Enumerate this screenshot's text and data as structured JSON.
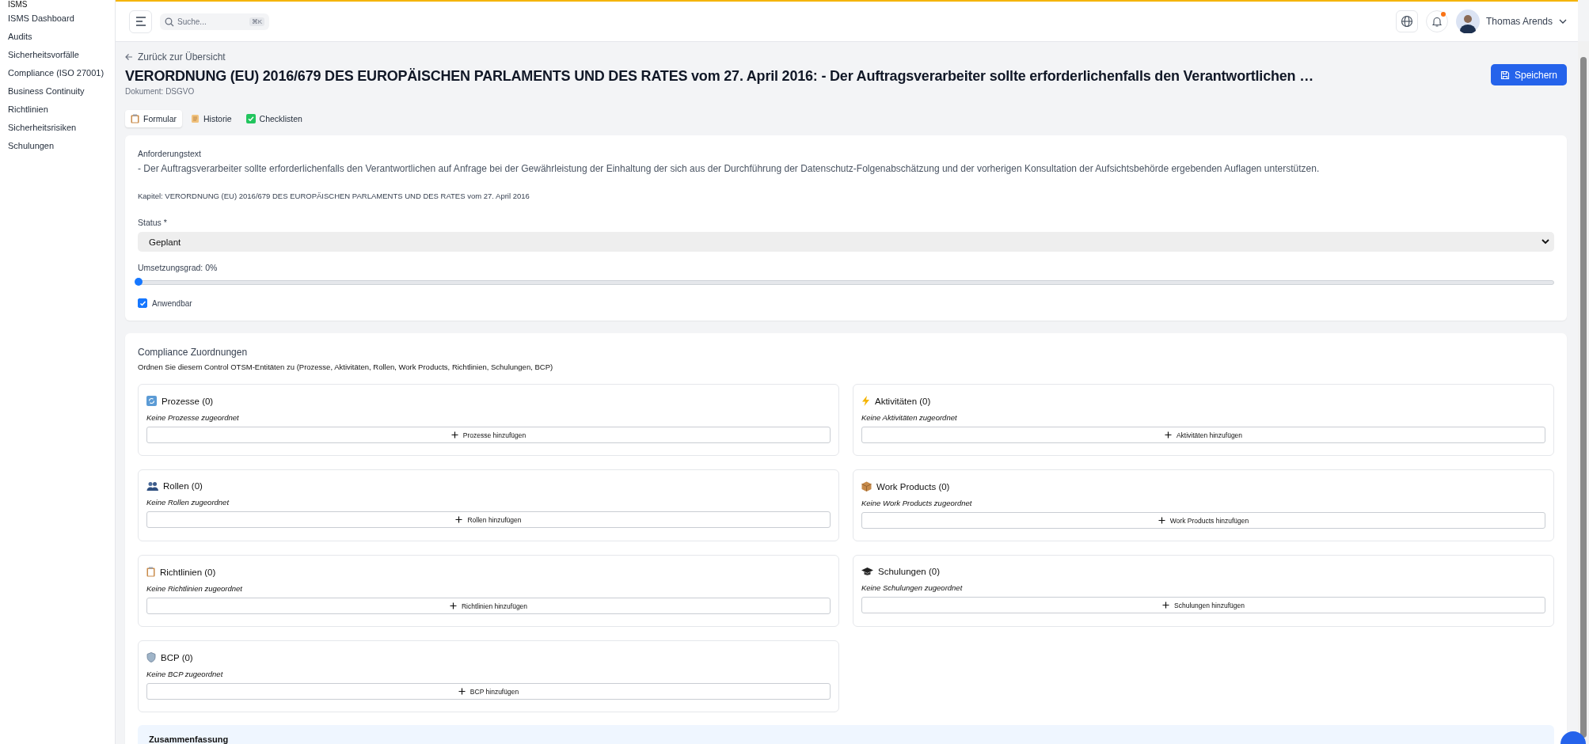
{
  "sidebar": {
    "section": "ISMS",
    "items": [
      {
        "label": "ISMS Dashboard",
        "selected": false
      },
      {
        "label": "Audits",
        "selected": false
      },
      {
        "label": "Sicherheitsvorfälle",
        "selected": false
      },
      {
        "label": "Compliance (ISO 27001)",
        "selected": false
      },
      {
        "label": "Business Continuity",
        "selected": false
      },
      {
        "label": "Richtlinien",
        "selected": false
      },
      {
        "label": "Sicherheitsrisiken",
        "selected": false
      },
      {
        "label": "Schulungen",
        "selected": false
      }
    ]
  },
  "header": {
    "search": {
      "placeholder": "Suche...",
      "shortcut": "⌘K"
    },
    "notification_dot": true,
    "user": {
      "name": "Thomas Arends"
    }
  },
  "page": {
    "back_link": "Zurück zur Übersicht",
    "title": "VERORDNUNG (EU) 2016/679 DES EUROPÄISCHEN PARLAMENTS UND DES RATES vom 27. April 2016: - Der Auftragsverarbeiter sollte erforderlichenfalls den Verantwortlichen …",
    "subtitle": "Dokument: DSGVO",
    "save_button": "Speichern"
  },
  "tabs": [
    {
      "label": "Formular",
      "kind": "form",
      "selected": true
    },
    {
      "label": "Historie",
      "kind": "history",
      "selected": false
    },
    {
      "label": "Checklisten",
      "kind": "checklist",
      "selected": false
    }
  ],
  "form": {
    "requirement_label": "Anforderungstext",
    "requirement_text": "- Der Auftragsverarbeiter sollte erforderlichenfalls den Verantwortlichen auf Anfrage bei der Gewährleistung der Einhaltung der sich aus der Durchführung der Datenschutz-Folgenabschätzung und der vorherigen Konsultation der Aufsichtsbehörde ergebenden Auflagen unterstützen.",
    "chapter": "Kapitel: VERORDNUNG (EU) 2016/679 DES EUROPÄISCHEN PARLAMENTS UND DES RATES vom 27. April 2016",
    "status_label": "Status *",
    "status_value": "Geplant",
    "progress_label": "Umsetzungsgrad: 0%",
    "progress": {
      "level": 0
    },
    "applicable": {
      "label": "Anwendbar",
      "checked": true
    }
  },
  "compliance": {
    "title": "Compliance Zuordnungen",
    "description": "Ordnen Sie diesem Control OTSM-Entitäten zu (Prozesse, Aktivitäten, Rollen, Work Products, Richtlinien, Schulungen, BCP)",
    "groups": [
      {
        "kind": "process",
        "title": "Prozesse (0)",
        "empty": "Keine Prozesse zugeordnet",
        "button": "Prozesse hinzufügen"
      },
      {
        "kind": "activity",
        "title": "Aktivitäten (0)",
        "empty": "Keine Aktivitäten zugeordnet",
        "button": "Aktivitäten hinzufügen"
      },
      {
        "kind": "role",
        "title": "Rollen (0)",
        "empty": "Keine Rollen zugeordnet",
        "button": "Rollen hinzufügen"
      },
      {
        "kind": "workproduct",
        "title": "Work Products (0)",
        "empty": "Keine Work Products zugeordnet",
        "button": "Work Products hinzufügen"
      },
      {
        "kind": "policy",
        "title": "Richtlinien (0)",
        "empty": "Keine Richtlinien zugeordnet",
        "button": "Richtlinien hinzufügen"
      },
      {
        "kind": "training",
        "title": "Schulungen (0)",
        "empty": "Keine Schulungen zugeordnet",
        "button": "Schulungen hinzufügen"
      },
      {
        "kind": "bcp",
        "title": "BCP (0)",
        "empty": "Keine BCP zugeordnet",
        "button": "BCP hinzufügen"
      }
    ]
  },
  "summary": {
    "title": "Zusammenfassung"
  }
}
